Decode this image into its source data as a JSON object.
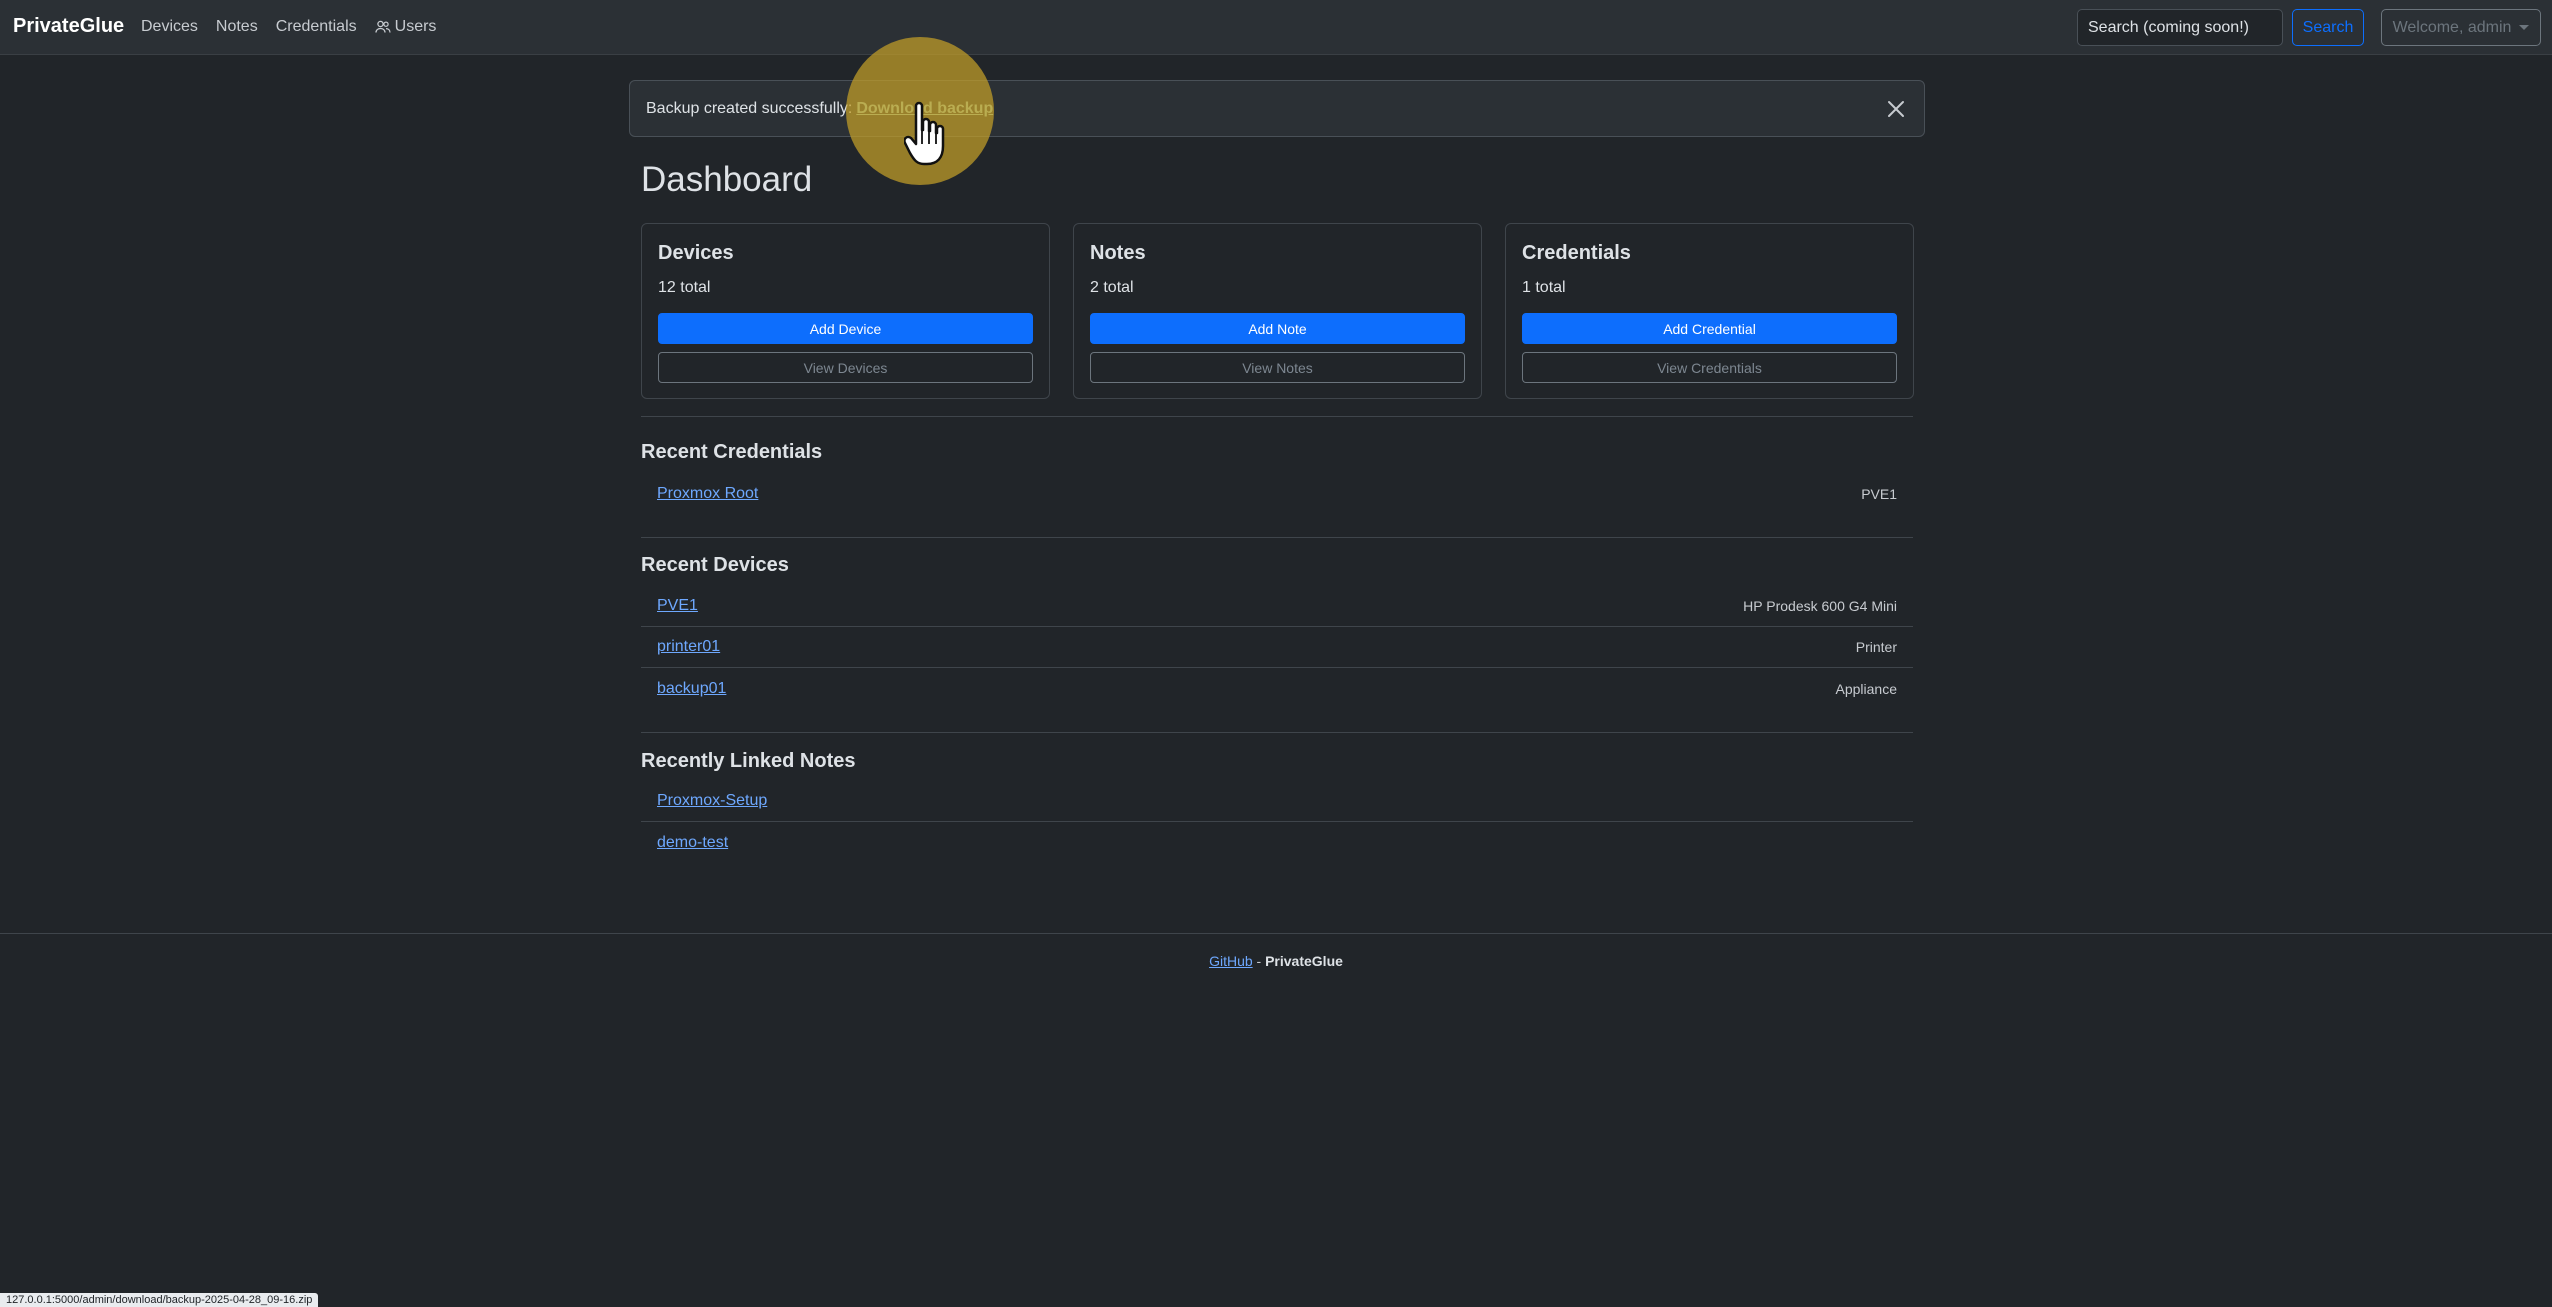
{
  "navbar": {
    "brand": "PrivateGlue",
    "links": [
      {
        "label": "Devices"
      },
      {
        "label": "Notes"
      },
      {
        "label": "Credentials"
      },
      {
        "label": "Users",
        "icon": "users-icon"
      }
    ],
    "search_placeholder": "Search (coming soon!)",
    "search_button": "Search",
    "user_menu": "Welcome, admin"
  },
  "alert": {
    "message": "Backup created successfully:",
    "link": "Download backup"
  },
  "dashboard": {
    "title": "Dashboard",
    "cards": [
      {
        "title": "Devices",
        "count": "12 total",
        "primary": "Add Device",
        "secondary": "View Devices"
      },
      {
        "title": "Notes",
        "count": "2 total",
        "primary": "Add Note",
        "secondary": "View Notes"
      },
      {
        "title": "Credentials",
        "count": "1 total",
        "primary": "Add Credential",
        "secondary": "View Credentials"
      }
    ]
  },
  "recent_credentials": {
    "title": "Recent Credentials",
    "items": [
      {
        "name": "Proxmox Root",
        "meta": "PVE1"
      }
    ]
  },
  "recent_devices": {
    "title": "Recent Devices",
    "items": [
      {
        "name": "PVE1",
        "meta": "HP Prodesk 600 G4 Mini"
      },
      {
        "name": "printer01",
        "meta": "Printer"
      },
      {
        "name": "backup01",
        "meta": "Appliance"
      }
    ]
  },
  "recent_notes": {
    "title": "Recently Linked Notes",
    "items": [
      {
        "name": "Proxmox-Setup"
      },
      {
        "name": "demo-test"
      }
    ]
  },
  "footer": {
    "link": "GitHub",
    "separator": " - ",
    "name": "PrivateGlue"
  },
  "status_bar": {
    "url": "127.0.0.1:5000/admin/download/backup-2025-04-28_09-16.zip"
  },
  "colors": {
    "background": "#212529",
    "navbar": "#2b3035",
    "primary": "#0d6efd",
    "link": "#6ea8fe",
    "alert_link": "#a3cfbb",
    "cursor_highlight": "#c4a028"
  }
}
